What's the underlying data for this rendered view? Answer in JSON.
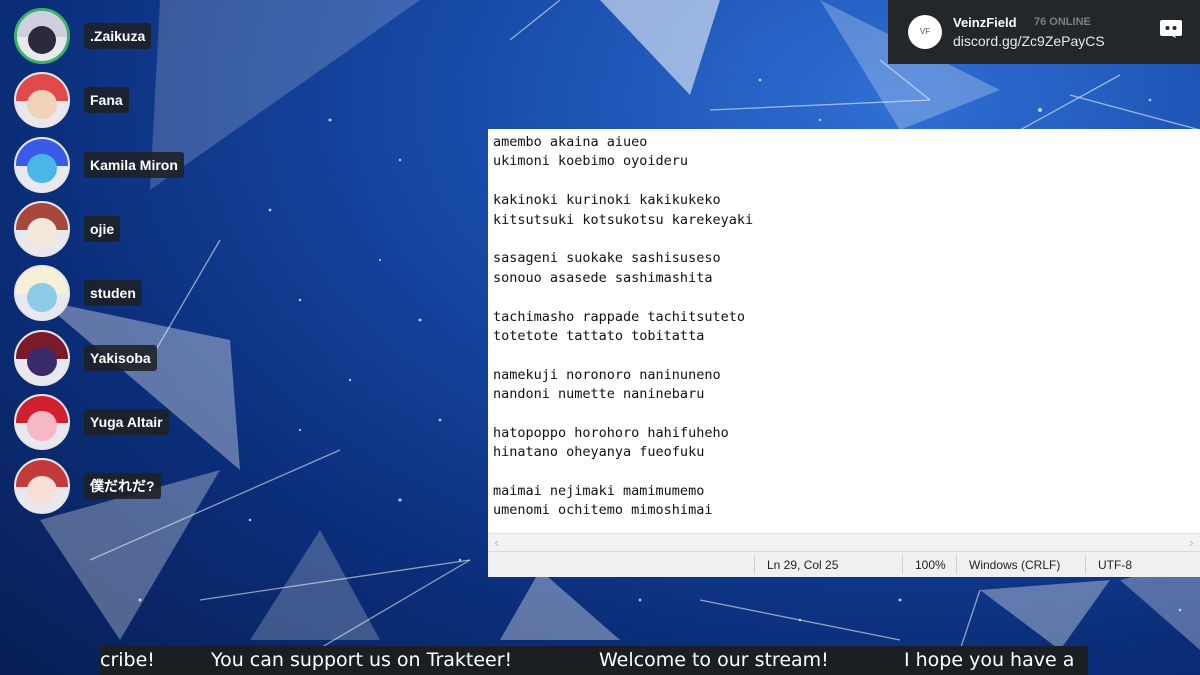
{
  "voice_members": [
    {
      "name": ".Zaikuza",
      "speaking": true,
      "colors": [
        "#cfcfe0",
        "#2a2a3a"
      ]
    },
    {
      "name": "Fana",
      "speaking": false,
      "colors": [
        "#e04a4a",
        "#f2d2b8"
      ]
    },
    {
      "name": "Kamila Miron",
      "speaking": false,
      "colors": [
        "#3a5be8",
        "#49b6e8"
      ]
    },
    {
      "name": "ojie",
      "speaking": false,
      "colors": [
        "#a8483c",
        "#f4e7dc"
      ]
    },
    {
      "name": "studen",
      "speaking": false,
      "colors": [
        "#f5f0d6",
        "#8ecbe8"
      ]
    },
    {
      "name": "Yakisoba",
      "speaking": false,
      "colors": [
        "#7a1a2a",
        "#3a2a6a"
      ]
    },
    {
      "name": "Yuga Altair",
      "speaking": false,
      "colors": [
        "#d02030",
        "#f6b8c4"
      ]
    },
    {
      "name": "僕だれだ?",
      "speaking": false,
      "colors": [
        "#c23a3a",
        "#f6e0d8"
      ]
    }
  ],
  "discord_widget": {
    "server_name": "VeinzField",
    "online": "76 ONLINE",
    "invite": "discord.gg/Zc9ZePayCS",
    "icon": "discord-logo-icon",
    "server_icon_label": "VF"
  },
  "notepad": {
    "lines": [
      "amembo akaina aiueo",
      "ukimoni koebimo oyoideru",
      "",
      "kakinoki kurinoki kakikukeko",
      "kitsutsuki kotsukotsu karekeyaki",
      "",
      "sasageni suokake sashisuseso",
      "sonouo asasede sashimashita",
      "",
      "tachimasho rappade tachitsuteto",
      "totetote tattato tobitatta",
      "",
      "namekuji noronoro naninuneno",
      "nandoni numette naninebaru",
      "",
      "hatopoppo horohoro hahifuheho",
      "hinatano oheyanya fueofuku",
      "",
      "maimai nejimaki mamimumemo",
      "umenomi ochitemo mimoshimai"
    ],
    "status": {
      "position": "Ln 29, Col 25",
      "zoom": "100%",
      "line_ending": "Windows (CRLF)",
      "encoding": "UTF-8"
    }
  },
  "ticker": {
    "items": [
      "cribe!",
      "You can support us on Trakteer!",
      "Welcome to our stream!",
      "I hope you have a"
    ]
  }
}
